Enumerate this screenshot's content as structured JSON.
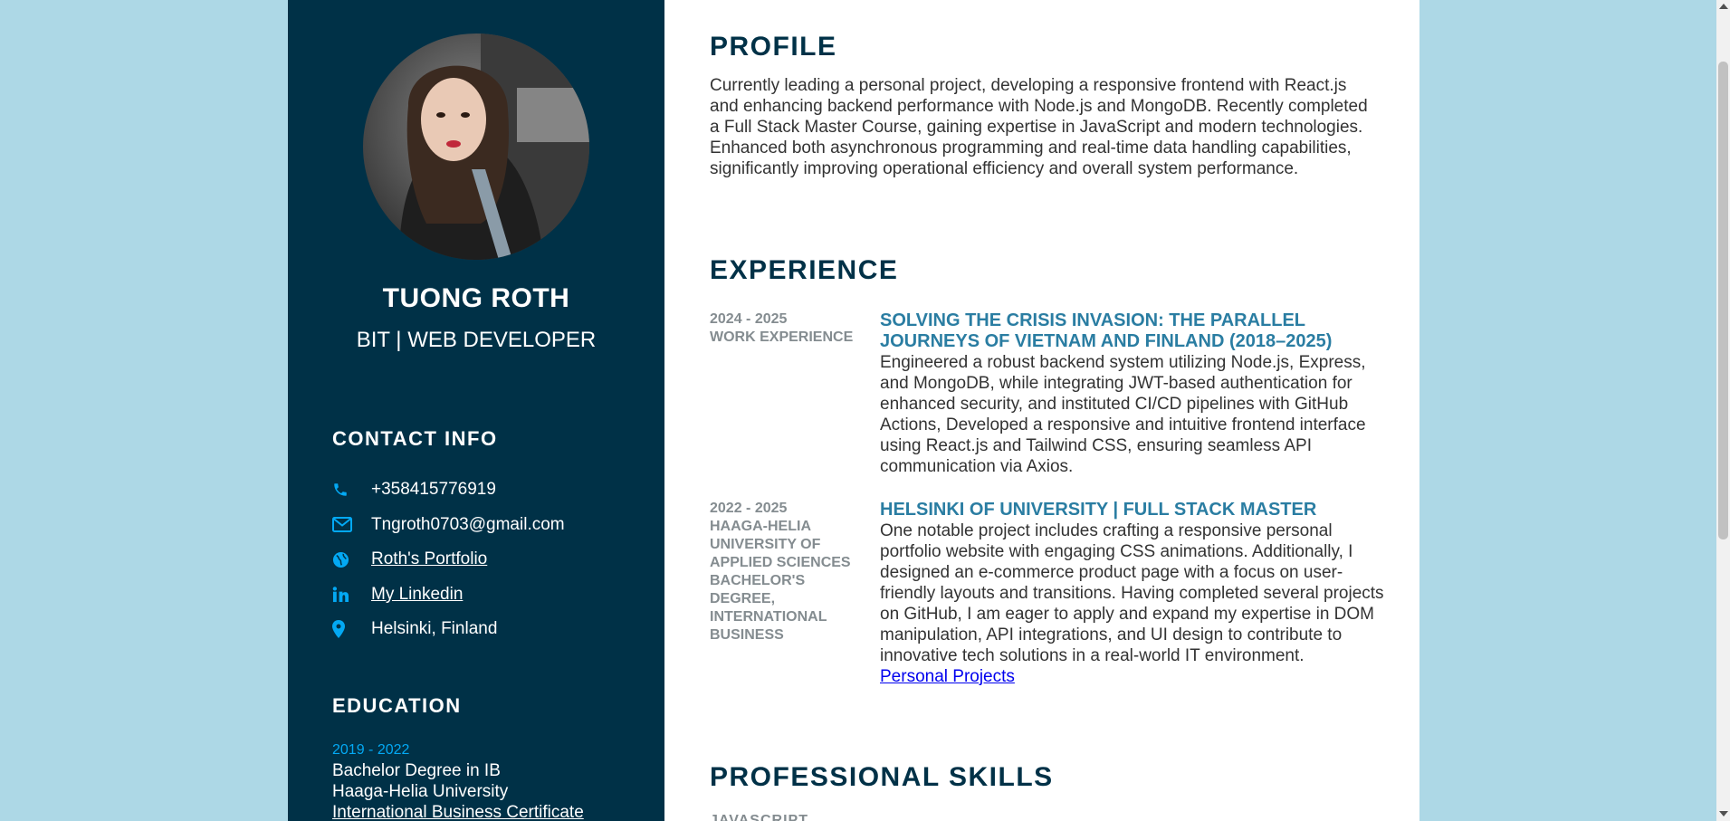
{
  "colors": {
    "background": "#add8e6",
    "sidebar": "#003147",
    "accent": "#03a9f4",
    "job_title": "#2a7da2",
    "meta_grey": "#848c90"
  },
  "sidebar": {
    "avatar_alt": "profile-photo",
    "name": "TUONG ROTH",
    "role": "BIT | WEB DEVELOPER",
    "contact_heading": "CONTACT INFO",
    "contacts": [
      {
        "icon": "phone-icon",
        "text": "+358415776919",
        "link": false
      },
      {
        "icon": "envelope-icon",
        "text": "Tngroth0703@gmail.com",
        "link": false
      },
      {
        "icon": "globe-icon",
        "text": "Roth's Portfolio",
        "link": true
      },
      {
        "icon": "linkedin-icon",
        "text": "My Linkedin",
        "link": true
      },
      {
        "icon": "map-pin-icon",
        "text": "Helsinki, Finland",
        "link": false
      }
    ],
    "education_heading": "EDUCATION",
    "education": {
      "year": "2019 - 2022",
      "degree": "Bachelor Degree in IB",
      "school": "Haaga-Helia University",
      "certificate_link": "International Business Certificate"
    }
  },
  "main": {
    "profile_heading": "PROFILE",
    "profile_text": "Currently leading a personal project, developing a responsive frontend with React.js and enhancing backend performance with Node.js and MongoDB. Recently completed a Full Stack Master Course, gaining expertise in JavaScript and modern technologies. Enhanced both asynchronous programming and real-time data handling capabilities, significantly improving operational efficiency and overall system performance.",
    "experience_heading": "EXPERIENCE",
    "experience": [
      {
        "years": "2024 - 2025",
        "place": "WORK EXPERIENCE",
        "title": "SOLVING THE CRISIS INVASION: THE PARALLEL JOURNEYS OF VIETNAM AND FINLAND (2018–2025)",
        "text": "Engineered a robust backend system utilizing Node.js, Express, and MongoDB, while integrating JWT-based authentication for enhanced security, and instituted CI/CD pipelines with GitHub Actions, Developed a responsive and intuitive frontend interface using React.js and Tailwind CSS, ensuring seamless API communication via Axios.",
        "link": ""
      },
      {
        "years": "2022 - 2025",
        "place": "HAAGA-HELIA UNIVERSITY OF APPLIED SCIENCES BACHELOR'S DEGREE, INTERNATIONAL BUSINESS",
        "title": "HELSINKI OF UNIVERSITY | FULL STACK MASTER",
        "text": "One notable project includes crafting a responsive personal portfolio website with engaging CSS animations. Additionally, I designed an e-commerce product page with a focus on user-friendly layouts and transitions. Having completed several projects on GitHub, I am eager to apply and expand my expertise in DOM manipulation, API integrations, and UI design to contribute to innovative tech solutions in a real-world IT environment.",
        "link": "Personal Projects"
      }
    ],
    "skills_heading": "PROFESSIONAL SKILLS",
    "skills_first_item": "JAVASCRIPT"
  }
}
